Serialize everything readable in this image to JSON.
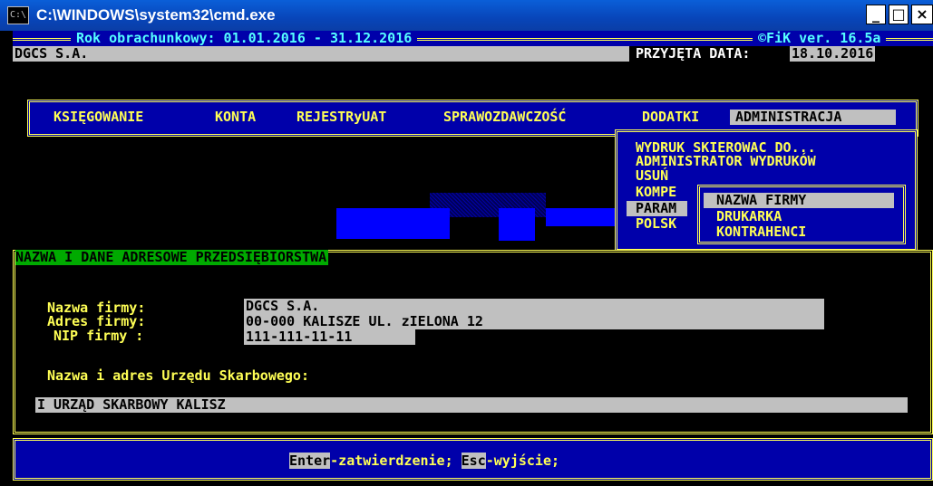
{
  "window": {
    "title": "C:\\WINDOWS\\system32\\cmd.exe",
    "icon": "cmd-icon"
  },
  "window_buttons": {
    "minimize": "_",
    "maximize": "□",
    "close": "×"
  },
  "header": {
    "year_label": "Rok obrachunkowy: 01.01.2016 - 31.12.2016",
    "version": "©FiK ver. 16.5a",
    "company": "DGCS S.A.",
    "date_label": "PRZYJĘTA DATA:",
    "date_value": "18.10.2016"
  },
  "menu": {
    "items": [
      "KSIĘGOWANIE",
      "KONTA",
      "REJESTRyUAT",
      "SPRAWOZDAWCZOŚĆ",
      "DODATKI",
      "ADMINISTRACJA"
    ],
    "active": "ADMINISTRACJA"
  },
  "admin_submenu": {
    "items": [
      "WYDRUK SKIEROWAC DO...",
      "ADMINISTRATOR WYDRUKÓW",
      "USUŃ",
      "KOMPE",
      "PARAM",
      "POLSK"
    ],
    "active": "PARAM"
  },
  "param_submenu": {
    "items": [
      "NAZWA FIRMY",
      "DRUKARKA",
      "KONTRAHENCI"
    ],
    "active": "NAZWA FIRMY"
  },
  "dialog": {
    "title": "NAZWA I DANE ADRESOWE PRZEDSIĘBIORSTWA",
    "fields": {
      "name": {
        "label": "Nazwa firmy:",
        "value": "DGCS S.A."
      },
      "address": {
        "label": "Adres firmy:",
        "value": "00-000 KALISZE UL. zIELONA 12"
      },
      "nip": {
        "label": "NIP firmy :",
        "value": "111-111-11-11"
      }
    },
    "tax_office_label": "Nazwa i adres Urzędu Skarbowego:",
    "tax_office_value": "I URZĄD SKARBOWY KALISZ"
  },
  "status_bar": {
    "enter_key": "Enter",
    "enter_text": "-zatwierdzenie; ",
    "esc_key": "Esc",
    "esc_text": "-wyjście;"
  },
  "colors": {
    "titlebar": "#0845b9",
    "console_bg": "#000000",
    "text_yellow": "#ffff55",
    "text_cyan": "#55ffff",
    "panel_blue": "#0000aa",
    "field_gray": "#c0c0c0",
    "dialog_title_green": "#00aa00"
  }
}
